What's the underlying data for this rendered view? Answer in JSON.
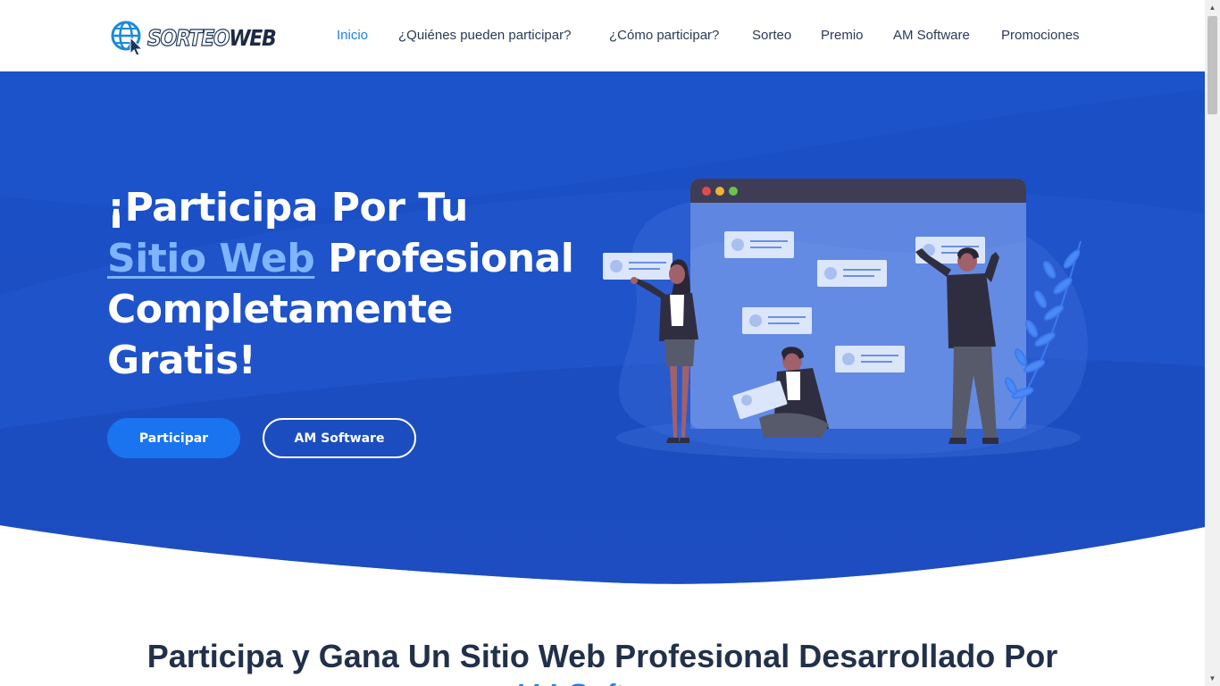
{
  "header": {
    "logo": {
      "text_a": "SORTEO",
      "text_b": "WEB",
      "icon": "globe-cursor-icon"
    },
    "nav": [
      {
        "label": "Inicio",
        "active": true
      },
      {
        "label": "¿Quiénes pueden participar?"
      },
      {
        "label": "¿Cómo participar?"
      },
      {
        "label": "Sorteo"
      },
      {
        "label": "Premio"
      },
      {
        "label": "AM Software"
      },
      {
        "label": "Promociones"
      }
    ]
  },
  "hero": {
    "title_line1": "¡Participa Por Tu",
    "title_highlight": "Sitio Web",
    "title_line2_rest": " Profesional",
    "title_line3": "Completamente",
    "title_line4": "Gratis!",
    "primary_button": "Participar",
    "secondary_button": "AM Software",
    "colors": {
      "hero_bg": "#1d4fc4",
      "hero_bg_light": "#2a5fd4",
      "accent": "#1a74f0",
      "highlight": "#7fb4ff"
    }
  },
  "section": {
    "title": "Participa y Gana Un Sitio Web Profesional Desarrollado Por",
    "subtitle_partial": "AM Software"
  }
}
